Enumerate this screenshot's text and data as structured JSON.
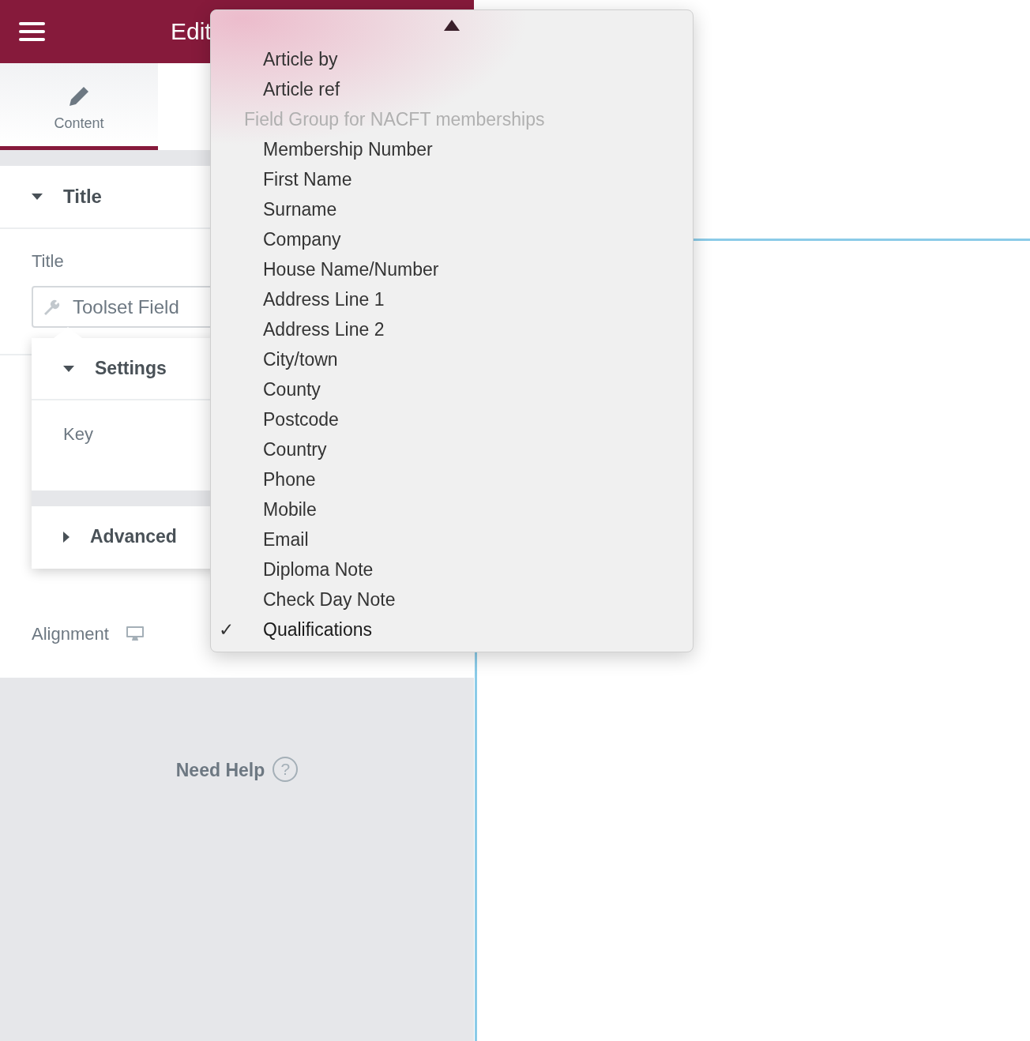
{
  "header": {
    "title": "Edit"
  },
  "tabs": [
    {
      "label": "Content",
      "selected": true
    }
  ],
  "section": {
    "title": "Title",
    "expanded": true
  },
  "title_control": {
    "label": "Title",
    "value": "Toolset Field"
  },
  "popup": {
    "sections": [
      {
        "title": "Settings",
        "expanded": true,
        "fields": [
          {
            "label": "Key"
          }
        ]
      },
      {
        "title": "Advanced",
        "expanded": false
      }
    ]
  },
  "alignment": {
    "label": "Alignment"
  },
  "help": {
    "label": "Need Help",
    "icon": "?"
  },
  "dropdown": {
    "check_mark": "✓",
    "items": [
      {
        "kind": "option",
        "label": "Article by",
        "selected": false
      },
      {
        "kind": "option",
        "label": "Article ref",
        "selected": false
      },
      {
        "kind": "group",
        "label": "Field Group for NACFT memberships"
      },
      {
        "kind": "option",
        "label": "Membership Number",
        "selected": false
      },
      {
        "kind": "option",
        "label": "First Name",
        "selected": false
      },
      {
        "kind": "option",
        "label": "Surname",
        "selected": false
      },
      {
        "kind": "option",
        "label": "Company",
        "selected": false
      },
      {
        "kind": "option",
        "label": "House Name/Number",
        "selected": false
      },
      {
        "kind": "option",
        "label": "Address Line 1",
        "selected": false
      },
      {
        "kind": "option",
        "label": "Address Line 2",
        "selected": false
      },
      {
        "kind": "option",
        "label": "City/town",
        "selected": false
      },
      {
        "kind": "option",
        "label": "County",
        "selected": false
      },
      {
        "kind": "option",
        "label": "Postcode",
        "selected": false
      },
      {
        "kind": "option",
        "label": "Country",
        "selected": false
      },
      {
        "kind": "option",
        "label": "Phone",
        "selected": false
      },
      {
        "kind": "option",
        "label": "Mobile",
        "selected": false
      },
      {
        "kind": "option",
        "label": "Email",
        "selected": false
      },
      {
        "kind": "option",
        "label": "Diploma Note",
        "selected": false
      },
      {
        "kind": "option",
        "label": "Check Day Note",
        "selected": false
      },
      {
        "kind": "option",
        "label": "Qualifications",
        "selected": true
      }
    ]
  }
}
